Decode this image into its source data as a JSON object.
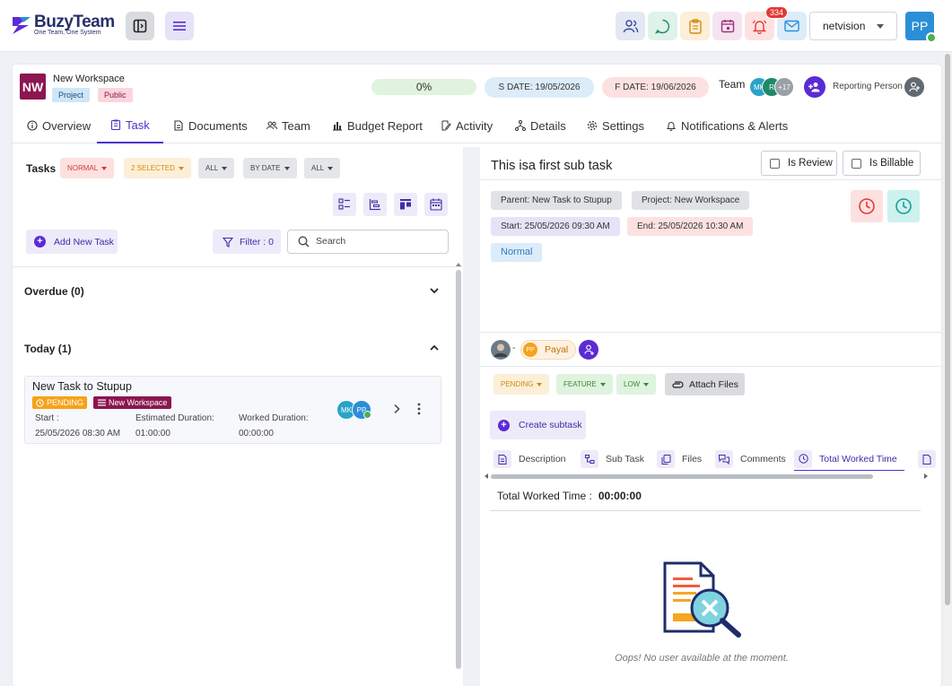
{
  "app": {
    "brand": "BuzyTeam",
    "tagline": "One Team, One System",
    "notification_count": "334",
    "org": "netvision",
    "user_initials": "PP"
  },
  "workspace": {
    "logo": "NW",
    "name": "New Workspace",
    "chips": [
      "Project",
      "Public"
    ],
    "progress": "0%",
    "start_date": "S DATE: 19/05/2026",
    "finish_date": "F DATE: 19/06/2026",
    "team_label": "Team",
    "team_avatars": [
      "MK",
      "R",
      "+17"
    ],
    "reporting_label": "Reporting Person"
  },
  "tabs": [
    {
      "label": "Overview",
      "icon": "info-icon"
    },
    {
      "label": "Task",
      "icon": "clipboard-icon"
    },
    {
      "label": "Documents",
      "icon": "document-icon"
    },
    {
      "label": "Team",
      "icon": "people-icon"
    },
    {
      "label": "Budget Report",
      "icon": "bar-chart-icon"
    },
    {
      "label": "Activity",
      "icon": "edit-doc-icon"
    },
    {
      "label": "Details",
      "icon": "hierarchy-icon"
    },
    {
      "label": "Settings",
      "icon": "gear-icon"
    },
    {
      "label": "Notifications & Alerts",
      "icon": "bell-icon"
    }
  ],
  "left": {
    "tasks_label": "Tasks",
    "filters": [
      "NORMAL",
      "2 SELECTED",
      "ALL",
      "BY DATE",
      "ALL"
    ],
    "add_task": "Add New Task",
    "filter_btn": "Filter : 0",
    "search_placeholder": "Search",
    "sections": [
      {
        "title": "Overdue (0)",
        "expanded": false
      },
      {
        "title": "Today (1)",
        "expanded": true
      }
    ],
    "task": {
      "title": "New Task to Stupup",
      "status": "PENDING",
      "workspace": "New Workspace",
      "start_label": "Start :",
      "start_value": "25/05/2026 08:30 AM",
      "est_label": "Estimated Duration:",
      "est_value": "01:00:00",
      "worked_label": "Worked Duration:",
      "worked_value": "00:00:00",
      "avatars": [
        "MK",
        "PP"
      ]
    }
  },
  "right": {
    "title": "This isa first sub task",
    "is_review": "Is Review",
    "is_billable": "Is Billable",
    "parent": "Parent:  New Task to Stupup",
    "project": "Project:  New Workspace",
    "start": "Start:  25/05/2026 09:30 AM",
    "end": "End:  25/05/2026 10:30 AM",
    "priority": "Normal",
    "assignee_sep": "-",
    "assignee_initials": "PP",
    "assignee_name": "Payal",
    "status_chips": [
      "PENDING",
      "FEATURE",
      "LOW"
    ],
    "attach": "Attach Files",
    "create_subtask": "Create subtask",
    "sub_tabs": [
      "Description",
      "Sub Task",
      "Files",
      "Comments",
      "Total Worked Time"
    ],
    "worked_label": "Total Worked Time :",
    "worked_value": "00:00:00",
    "empty_msg": "Oops! No user available at the moment."
  },
  "colors": {
    "accent": "#4b32c8",
    "workspace": "#8b1650",
    "pending": "#f6a21a"
  }
}
